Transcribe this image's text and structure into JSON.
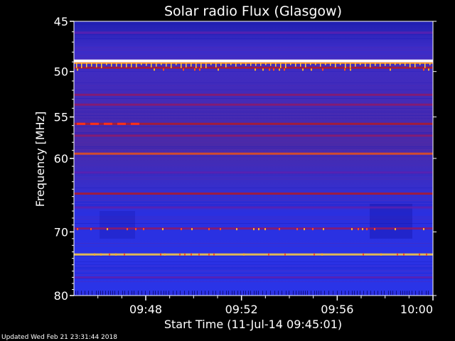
{
  "chart_data": {
    "type": "heatmap",
    "title": "Solar radio Flux (Glasgow)",
    "xlabel": "Start Time (11-Jul-14 09:45:01)",
    "ylabel": "Frequency [MHz]",
    "x_range": [
      "09:45:01",
      "10:00:00"
    ],
    "xlim_minutes": [
      0,
      15
    ],
    "x_ticks": [
      {
        "label": "09:48",
        "minutes": 3
      },
      {
        "label": "09:52",
        "minutes": 7
      },
      {
        "label": "09:56",
        "minutes": 11
      },
      {
        "label": "10:00",
        "minutes": 15
      }
    ],
    "ylim": [
      45,
      80
    ],
    "y_scale": "log",
    "y_axis_inverted": true,
    "y_ticks": [
      {
        "label": "45",
        "value": 45
      },
      {
        "label": "50",
        "value": 50
      },
      {
        "label": "55",
        "value": 55
      },
      {
        "label": "60",
        "value": 60
      },
      {
        "label": "70",
        "value": 70
      },
      {
        "label": "80",
        "value": 80
      }
    ],
    "colormap": [
      "#1010c8",
      "#2a2ae0",
      "#5a20b0",
      "#8c1a6a",
      "#b01a28",
      "#e8501a",
      "#ffd040",
      "#ffffff"
    ],
    "bands": [
      {
        "freq": 46.1,
        "intensity": 0.3
      },
      {
        "freq": 48.9,
        "intensity": 1.0
      },
      {
        "freq": 49.6,
        "intensity": 0.55
      },
      {
        "freq": 52.5,
        "intensity": 0.45
      },
      {
        "freq": 53.6,
        "intensity": 0.4
      },
      {
        "freq": 55.8,
        "intensity": 0.55
      },
      {
        "freq": 57.2,
        "intensity": 0.38
      },
      {
        "freq": 59.4,
        "intensity": 0.7
      },
      {
        "freq": 61.8,
        "intensity": 0.35
      },
      {
        "freq": 64.6,
        "intensity": 0.62
      },
      {
        "freq": 66.5,
        "intensity": 0.3
      },
      {
        "freq": 69.5,
        "intensity": 0.42
      },
      {
        "freq": 73.4,
        "intensity": 0.82
      },
      {
        "freq": 77.0,
        "intensity": 0.35
      }
    ]
  },
  "footer": {
    "updated": "Updated Wed Feb 21 23:31:44 2018"
  }
}
